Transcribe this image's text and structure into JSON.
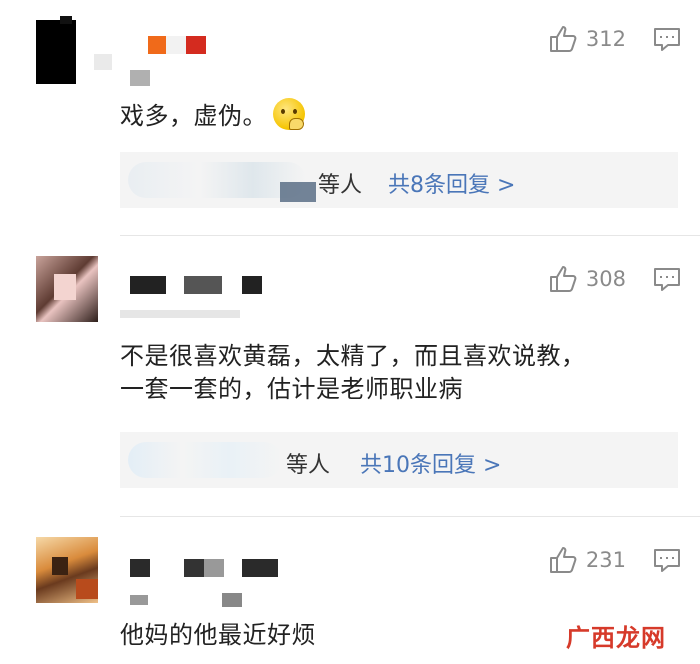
{
  "comments": [
    {
      "likes": "312",
      "text": "戏多，虚伪。",
      "replies_who": "等人",
      "replies_count": "共8条回复 >"
    },
    {
      "likes": "308",
      "text_line1": "不是很喜欢黄磊，太精了，而且喜欢说教，",
      "text_line2": "一套一套的，估计是老师职业病",
      "replies_who": "等人",
      "replies_count": "共10条回复 >"
    },
    {
      "likes": "231",
      "text": "他妈的他最近好烦"
    }
  ],
  "watermark": "广西龙网"
}
